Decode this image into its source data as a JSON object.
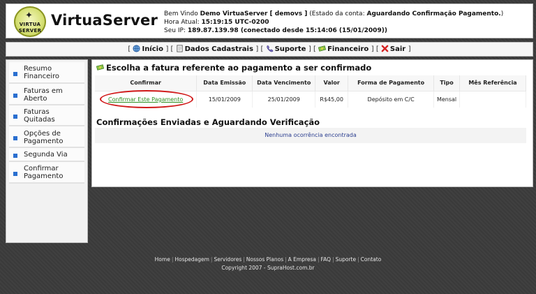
{
  "header": {
    "logo_text_line1": "VIRTUA",
    "logo_text_line2": "SERVER",
    "brand": "VirtuaServer",
    "welcome_prefix": "Bem Vindo",
    "user_name": "Demo VirtuaServer [ demovs ]",
    "account_state_prefix": "(Estado da conta:",
    "account_state": "Aguardando Confirmação Pagamento.",
    "account_state_suffix": ")",
    "time_label": "Hora Atual:",
    "time_value": "15:19:15 UTC-0200",
    "ip_label": "Seu IP:",
    "ip_value": "189.87.139.98 (conectado desde 15:14:06 (15/01/2009))"
  },
  "nav": {
    "items": [
      {
        "label": "Início",
        "icon": "globe-icon"
      },
      {
        "label": "Dados Cadastrais",
        "icon": "document-icon"
      },
      {
        "label": "Suporte",
        "icon": "phone-icon"
      },
      {
        "label": "Financeiro",
        "icon": "money-icon"
      },
      {
        "label": "Sair",
        "icon": "x-icon"
      }
    ]
  },
  "sidebar": {
    "items": [
      {
        "line1": "Resumo",
        "line2": "Financeiro"
      },
      {
        "line1": "Faturas em",
        "line2": "Aberto"
      },
      {
        "line1": "Faturas",
        "line2": "Quitadas"
      },
      {
        "line1": "Opções de",
        "line2": "Pagamento"
      },
      {
        "line1": "Segunda Via",
        "line2": ""
      },
      {
        "line1": "Confirmar",
        "line2": "Pagamento"
      }
    ]
  },
  "main": {
    "title": "Escolha a fatura referente ao pagamento a ser confirmado",
    "table": {
      "headers": [
        "Confirmar",
        "Data Emissão",
        "Data Vencimento",
        "Valor",
        "Forma de Pagamento",
        "Tipo",
        "Mês Referência"
      ],
      "row": {
        "confirm_link": "Confirmar Este Pagamento",
        "issue_date": "15/01/2009",
        "due_date": "25/01/2009",
        "value": "R$45,00",
        "payment_method": "Depósito em C/C",
        "type": "Mensal",
        "reference_month": ""
      }
    },
    "section2_title": "Confirmações Enviadas e Aguardando Verificação",
    "empty_message": "Nenhuma ocorrência encontrada"
  },
  "footer": {
    "links": [
      "Home",
      "Hospedagem",
      "Servidores",
      "Nossos Planos",
      "A Empresa",
      "FAQ",
      "Suporte",
      "Contato"
    ],
    "copyright": "Copyright 2007 - SupraHost.com.br"
  },
  "colors": {
    "accent_green": "#2f8f22",
    "highlight_red": "#d01818",
    "bullet_blue": "#2a6fd0",
    "empty_text_blue": "#2a3d8f"
  }
}
